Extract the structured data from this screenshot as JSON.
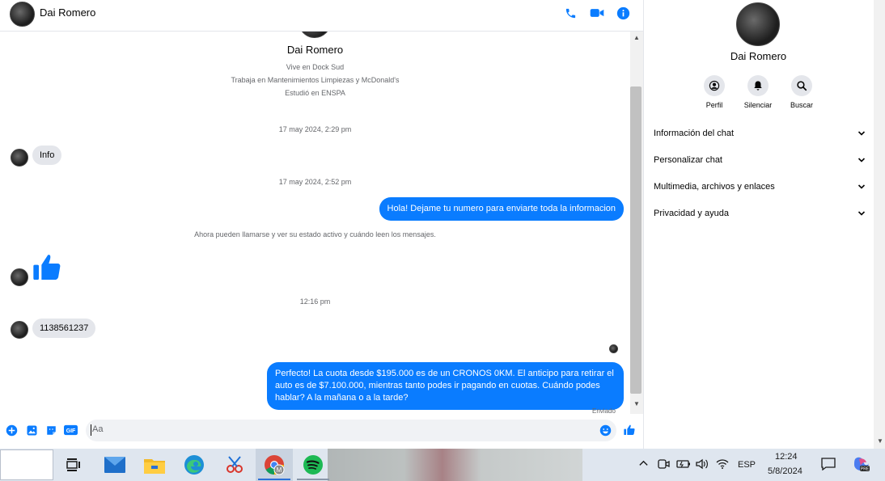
{
  "chat": {
    "contact_name": "Dai Romero",
    "profile": {
      "name": "Dai Romero",
      "lives": "Vive en Dock Sud",
      "works": "Trabaja en Mantenimientos Limpiezas y McDonald's",
      "studied": "Estudió en ENSPA"
    },
    "timestamps": {
      "t1": "17 may 2024, 2:29 pm",
      "t2": "17 may 2024, 2:52 pm",
      "t3": "12:16 pm"
    },
    "messages": {
      "m1": "Info",
      "m2": "Hola! Dejame tu numero  para enviarte toda la informacion",
      "system": "Ahora pueden llamarse y ver su estado activo y cuándo leen los mensajes.",
      "m4": "1138561237",
      "m5": "Perfecto! La cuota desde $195.000 es de un CRONOS 0KM. El anticipo para retirar el auto es de $7.100.000, mientras tanto podes ir pagando en cuotas. Cuándo podes hablar? A la mañana o a la tarde?"
    },
    "status": "Enviado",
    "composer_placeholder": "Aa",
    "colors": {
      "accent": "#0a7cff",
      "incoming_bubble": "#e4e6eb"
    }
  },
  "right_panel": {
    "name": "Dai Romero",
    "actions": {
      "profile": "Perfil",
      "mute": "Silenciar",
      "search": "Buscar"
    },
    "sections": {
      "info": "Información del chat",
      "customize": "Personalizar chat",
      "media": "Multimedia, archivos y enlaces",
      "privacy": "Privacidad y ayuda"
    }
  },
  "taskbar": {
    "language": "ESP",
    "time": "12:24",
    "date": "5/8/2024",
    "apps": [
      "task-view-icon",
      "mail-icon",
      "file-explorer-icon",
      "edge-icon",
      "snipping-tool-icon",
      "chrome-icon",
      "spotify-icon"
    ]
  }
}
